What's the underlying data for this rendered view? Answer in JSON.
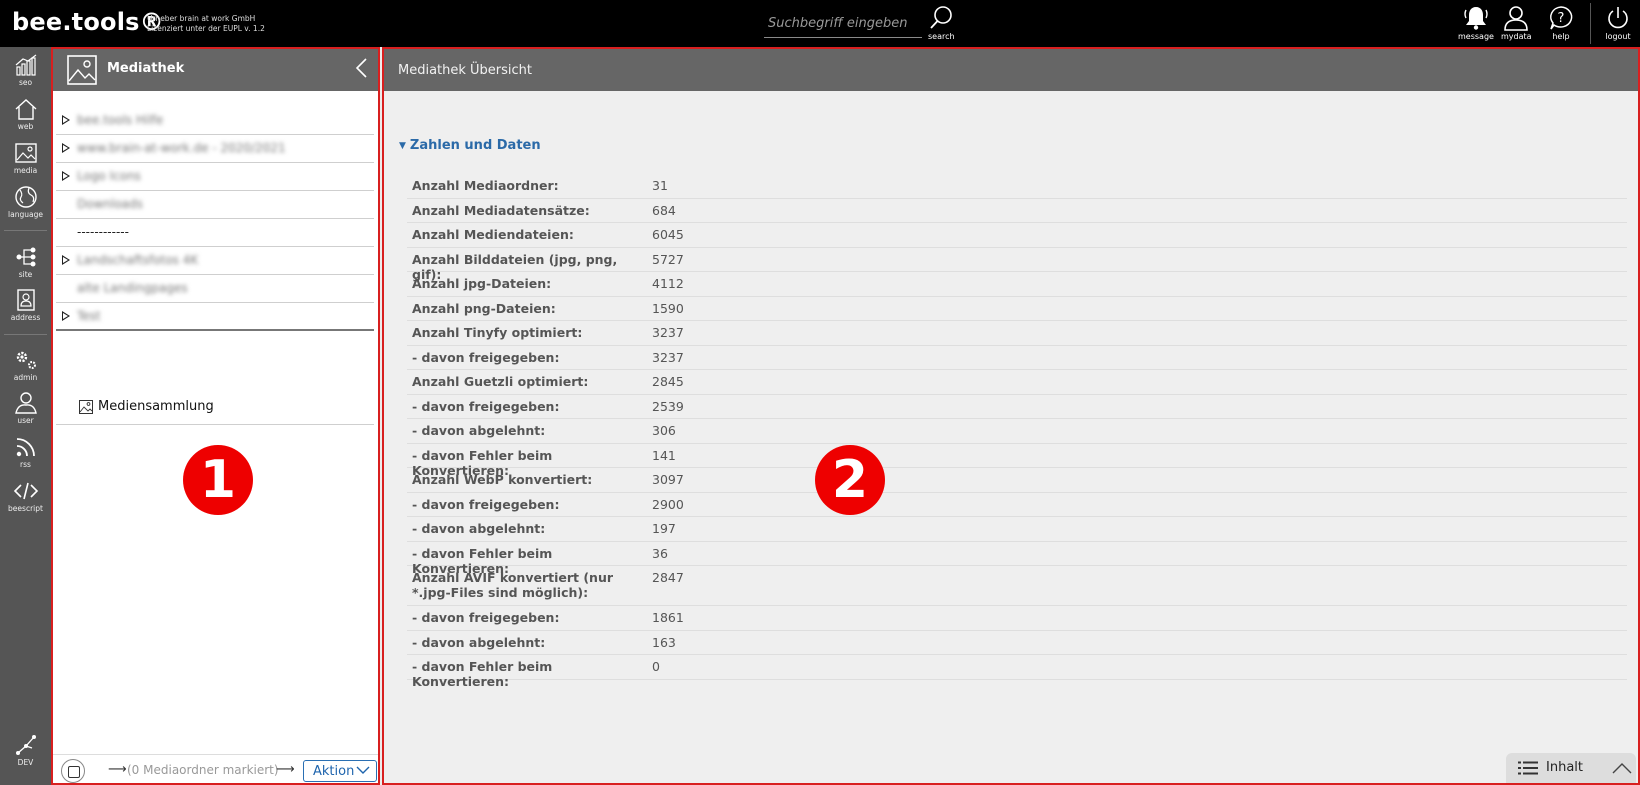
{
  "header": {
    "brand": "bee.tools®",
    "brand_sub_line1": "Urheber brain at work GmbH",
    "brand_sub_line2": "Lizenziert unter der EUPL v. 1.2",
    "search_placeholder": "Suchbegriff eingeben",
    "search_label": "search",
    "actions": {
      "message": "message",
      "mydata": "mydata",
      "help": "help",
      "logout": "logout"
    }
  },
  "rail": {
    "seo": "seo",
    "web": "web",
    "media": "media",
    "language": "language",
    "site": "site",
    "address": "address",
    "admin": "admin",
    "user": "user",
    "rss": "rss",
    "beescript": "beescript",
    "dev": "DEV"
  },
  "panel1": {
    "title": "Mediathek",
    "tree": [
      {
        "label": "bee.tools Hilfe",
        "expandable": true,
        "blurred": true
      },
      {
        "label": "www.brain-at-work.de - 2020/2021",
        "expandable": true,
        "blurred": true
      },
      {
        "label": "Logo Icons",
        "expandable": true,
        "blurred": true
      },
      {
        "label": "Downloads",
        "expandable": false,
        "blurred": true
      },
      {
        "label": "------------",
        "expandable": false,
        "blurred": false
      },
      {
        "label": "Landschaftsfotos 4K",
        "expandable": true,
        "blurred": true
      },
      {
        "label": "alte Landingpages",
        "expandable": false,
        "blurred": true
      },
      {
        "label": "Test",
        "expandable": true,
        "blurred": true
      }
    ],
    "collection": "Mediensammlung",
    "marker": "1",
    "footer": {
      "arrow": "⟶",
      "marked_text": "(0 Mediaordner markiert)",
      "action_button": "Aktion"
    }
  },
  "panel2": {
    "title": "Mediathek Übersicht",
    "section_title": "Zahlen und Daten",
    "marker": "2",
    "stats": [
      {
        "label": "Anzahl Mediaordner:",
        "value": "31"
      },
      {
        "label": "Anzahl Mediadatensätze:",
        "value": "684"
      },
      {
        "label": "Anzahl Mediendateien:",
        "value": "6045"
      },
      {
        "label": "Anzahl Bilddateien (jpg, png, gif):",
        "value": "5727"
      },
      {
        "label": "Anzahl jpg-Dateien:",
        "value": "4112"
      },
      {
        "label": "Anzahl png-Dateien:",
        "value": "1590"
      },
      {
        "label": "Anzahl Tinyfy optimiert:",
        "value": "3237"
      },
      {
        "label": "- davon freigegeben:",
        "value": "3237"
      },
      {
        "label": "Anzahl Guetzli optimiert:",
        "value": "2845"
      },
      {
        "label": "- davon freigegeben:",
        "value": "2539"
      },
      {
        "label": "- davon abgelehnt:",
        "value": "306"
      },
      {
        "label": "- davon Fehler beim Konvertieren:",
        "value": "141"
      },
      {
        "label": "Anzahl WebP konvertiert:",
        "value": "3097"
      },
      {
        "label": "- davon freigegeben:",
        "value": "2900"
      },
      {
        "label": "- davon abgelehnt:",
        "value": "197"
      },
      {
        "label": "- davon Fehler beim Konvertieren:",
        "value": "36"
      },
      {
        "label": "Anzahl AVIF konvertiert (nur *.jpg-Files sind möglich):",
        "value": "2847"
      },
      {
        "label": "- davon freigegeben:",
        "value": "1861"
      },
      {
        "label": "- davon abgelehnt:",
        "value": "163"
      },
      {
        "label": "- davon Fehler beim Konvertieren:",
        "value": "0"
      }
    ],
    "inhalt_tab": "Inhalt"
  }
}
